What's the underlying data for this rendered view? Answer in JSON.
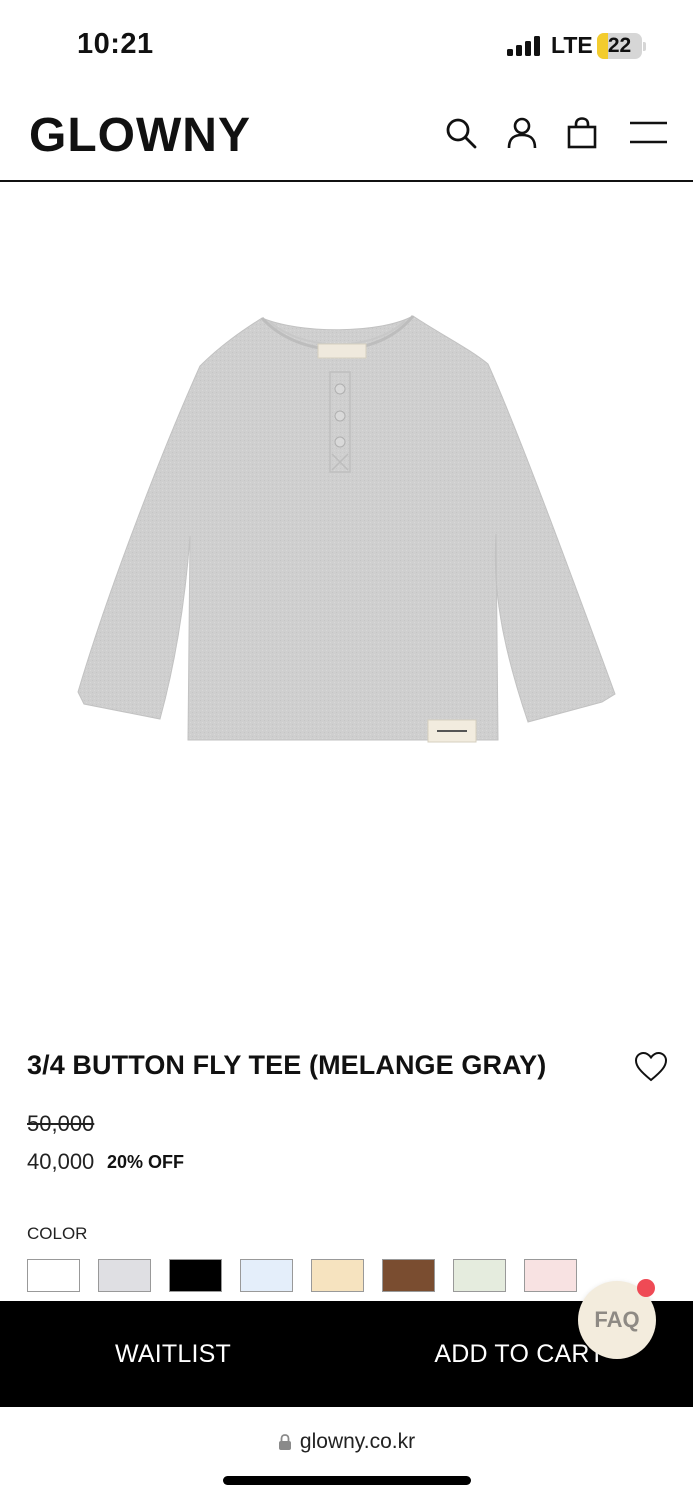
{
  "status_bar": {
    "time": "10:21",
    "network": "LTE",
    "battery": "22",
    "signal_icon": "cellular-signal-icon",
    "battery_icon": "battery-icon"
  },
  "header": {
    "logo": "GLOWNY",
    "icons": [
      "search-icon",
      "user-icon",
      "shopping-bag-icon",
      "menu-icon"
    ]
  },
  "product": {
    "image_icon": "product-photo-gray-henley-tee",
    "title": "3/4 BUTTON FLY TEE (MELANGE GRAY)",
    "wishlist_icon": "heart-icon",
    "price_original": "50,000",
    "price_sale": "40,000",
    "discount": "20% OFF",
    "color_label": "COLOR",
    "colors": [
      "#ffffff",
      "#dfdfe3",
      "#000000",
      "#e4eefa",
      "#f6e3bf",
      "#7a4d30",
      "#e5ecde",
      "#f8e2e2"
    ]
  },
  "actions": {
    "waitlist": "WAITLIST",
    "add_to_cart": "ADD TO CART"
  },
  "faq": {
    "label": "FAQ",
    "accent": "#ef4a55"
  },
  "browser": {
    "url": "glowny.co.kr",
    "lock_icon": "lock-icon"
  }
}
